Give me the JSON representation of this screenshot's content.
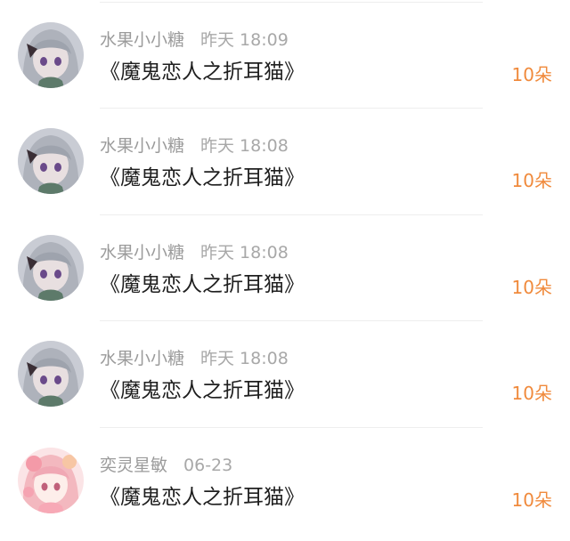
{
  "gifts": [
    {
      "username": "水果小小糖",
      "time": "昨天 18:09",
      "work_title": "《魔鬼恋人之折耳猫》",
      "gift_count": "10朵",
      "avatar": "gray-haired-anime-girl-avatar"
    },
    {
      "username": "水果小小糖",
      "time": "昨天 18:08",
      "work_title": "《魔鬼恋人之折耳猫》",
      "gift_count": "10朵",
      "avatar": "gray-haired-anime-girl-avatar"
    },
    {
      "username": "水果小小糖",
      "time": "昨天 18:08",
      "work_title": "《魔鬼恋人之折耳猫》",
      "gift_count": "10朵",
      "avatar": "gray-haired-anime-girl-avatar"
    },
    {
      "username": "水果小小糖",
      "time": "昨天 18:08",
      "work_title": "《魔鬼恋人之折耳猫》",
      "gift_count": "10朵",
      "avatar": "gray-haired-anime-girl-avatar"
    },
    {
      "username": "奕灵星敏",
      "time": "06-23",
      "work_title": "《魔鬼恋人之折耳猫》",
      "gift_count": "10朵",
      "avatar": "pink-haired-anime-girl-avatar"
    }
  ],
  "colors": {
    "username": "#9b9b9b",
    "time": "#a8a8a8",
    "title": "#1f1f1f",
    "gift_accent": "#f08a3c",
    "divider": "#eeeeee"
  }
}
